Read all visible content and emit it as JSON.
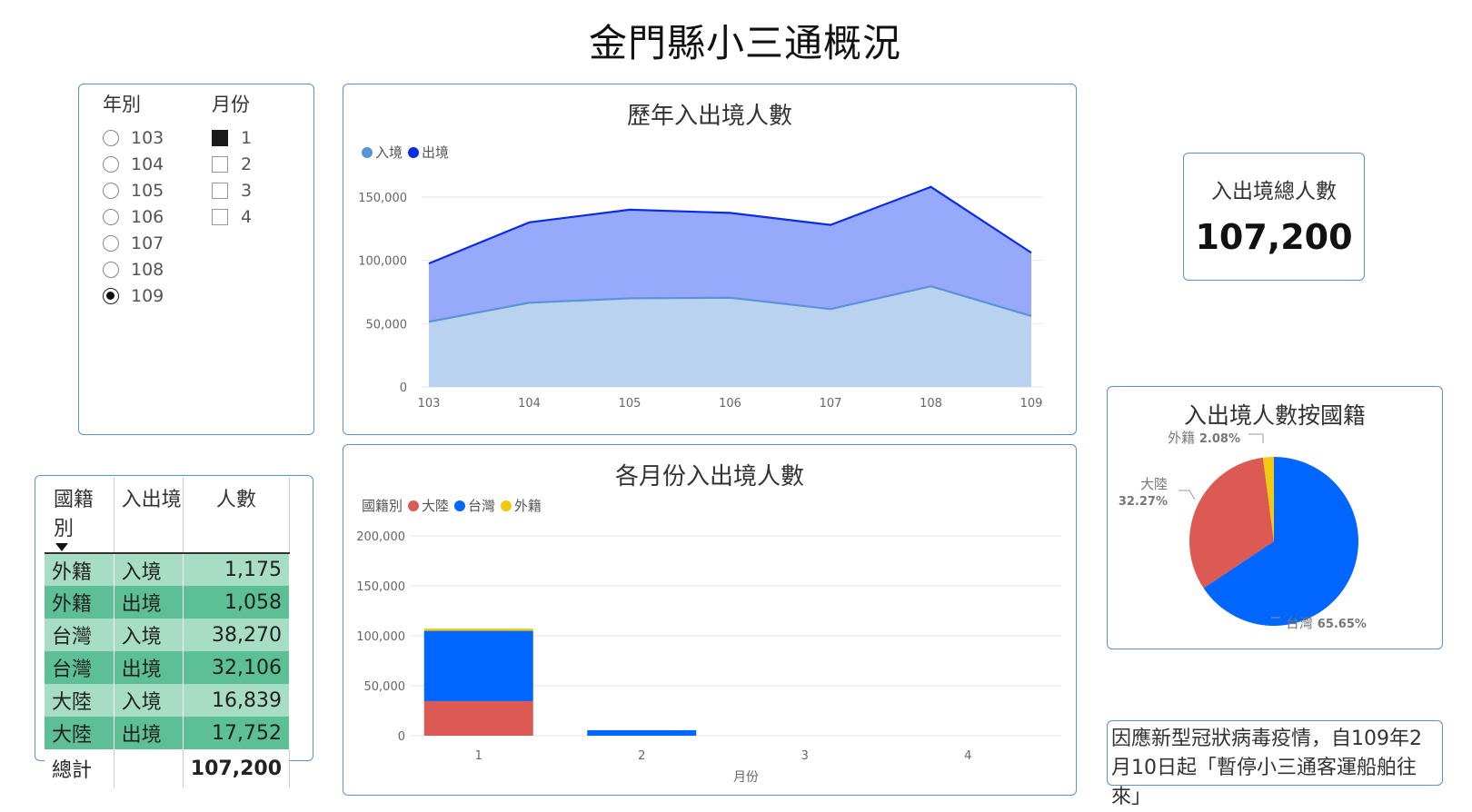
{
  "page_title": "金門縣小三通概況",
  "slicer": {
    "year_header": "年別",
    "month_header": "月份",
    "years": [
      "103",
      "104",
      "105",
      "106",
      "107",
      "108",
      "109"
    ],
    "selected_year": "109",
    "months": [
      "1",
      "2",
      "3",
      "4"
    ],
    "selected_month": "1"
  },
  "kpi": {
    "label": "入出境總人數",
    "value": "107,200"
  },
  "note": "因應新型冠狀病毒疫情，自109年2月10日起「暫停小三通客運船舶往來」",
  "table": {
    "headers": [
      "國籍別",
      "入出境",
      "人數"
    ],
    "rows": [
      {
        "nationality": "外籍",
        "direction": "入境",
        "count": "1,175"
      },
      {
        "nationality": "外籍",
        "direction": "出境",
        "count": "1,058"
      },
      {
        "nationality": "台灣",
        "direction": "入境",
        "count": "38,270"
      },
      {
        "nationality": "台灣",
        "direction": "出境",
        "count": "32,106"
      },
      {
        "nationality": "大陸",
        "direction": "入境",
        "count": "16,839"
      },
      {
        "nationality": "大陸",
        "direction": "出境",
        "count": "17,752"
      }
    ],
    "total_label": "總計",
    "total_value": "107,200"
  },
  "colors": {
    "inbound": "#5b93d6",
    "outbound": "#0a2be6",
    "mainland": "#dc5a54",
    "taiwan": "#0066ff",
    "foreign": "#f2c811",
    "table_light": "#a6ddc4",
    "table_dark": "#5cbf96",
    "panel_border": "#5b8fd6"
  },
  "chart_data": [
    {
      "id": "yearly",
      "type": "area",
      "title": "歷年入出境人數",
      "categories": [
        "103",
        "104",
        "105",
        "106",
        "107",
        "108",
        "109"
      ],
      "series": [
        {
          "name": "入境",
          "values": [
            51500,
            66500,
            70000,
            70500,
            61500,
            79500,
            56000
          ]
        },
        {
          "name": "出境",
          "values": [
            97500,
            130000,
            140000,
            137500,
            128000,
            158000,
            106000
          ]
        }
      ],
      "stacked": false,
      "ylim": [
        0,
        160000
      ],
      "yticks": [
        0,
        50000,
        100000,
        150000
      ],
      "ytick_labels": [
        "0",
        "50,000",
        "100,000",
        "150,000"
      ],
      "legend_position": "top-left",
      "grid": true
    },
    {
      "id": "monthly",
      "type": "bar",
      "stacked": true,
      "title": "各月份入出境人數",
      "legend_title": "國籍別",
      "xlabel": "月份",
      "categories": [
        "1",
        "2",
        "3",
        "4"
      ],
      "series": [
        {
          "name": "大陸",
          "values": [
            34591,
            0,
            0,
            0
          ]
        },
        {
          "name": "台灣",
          "values": [
            70376,
            5500,
            0,
            0
          ]
        },
        {
          "name": "外籍",
          "values": [
            2233,
            0,
            0,
            0
          ]
        }
      ],
      "ylim": [
        0,
        200000
      ],
      "yticks": [
        0,
        50000,
        100000,
        150000,
        200000
      ],
      "ytick_labels": [
        "0",
        "50,000",
        "100,000",
        "150,000",
        "200,000"
      ],
      "legend_position": "top-left",
      "grid": true
    },
    {
      "id": "nationality",
      "type": "pie",
      "title": "入出境人數按國籍",
      "slices": [
        {
          "name": "台灣",
          "value": 65.65,
          "label": "65.65%"
        },
        {
          "name": "大陸",
          "value": 32.27,
          "label": "32.27%"
        },
        {
          "name": "外籍",
          "value": 2.08,
          "label": "2.08%"
        }
      ]
    }
  ]
}
